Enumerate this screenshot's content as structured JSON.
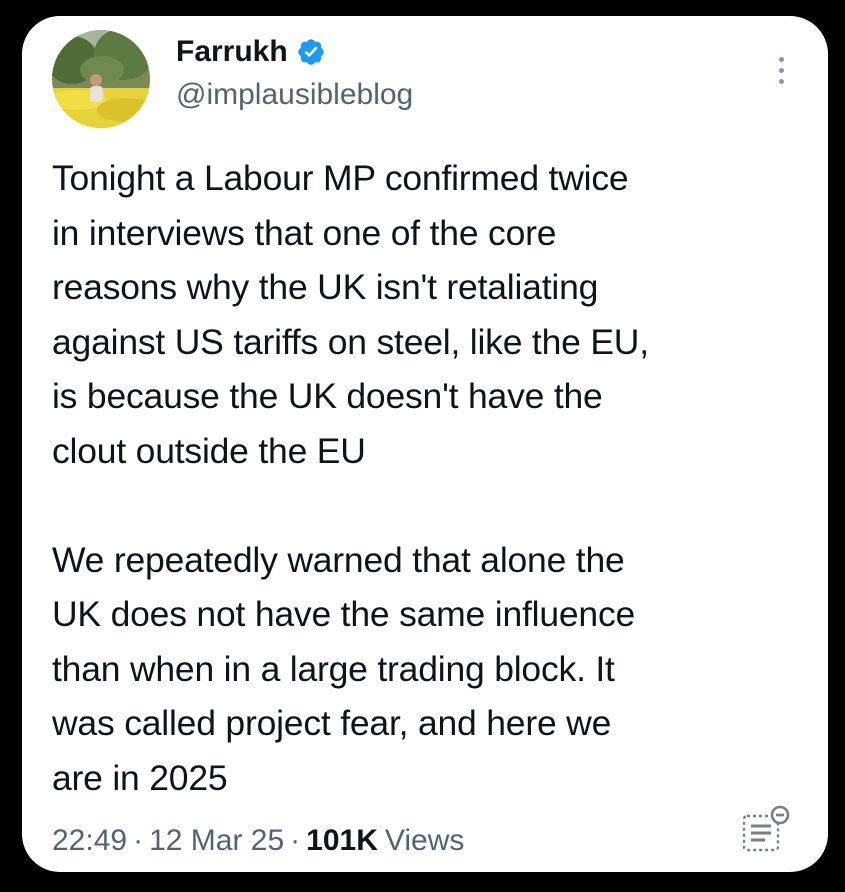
{
  "author": {
    "display_name": "Farrukh",
    "handle": "@implausibleblog",
    "verified_icon": "verified-badge-icon",
    "verified_color": "#1d9bf0"
  },
  "tweet": {
    "text": "Tonight a Labour MP confirmed twice\nin interviews that one of the core\nreasons why the UK isn't retaliating\nagainst US tariffs on steel, like the EU,\nis because the UK doesn't have the\nclout outside the EU\n\nWe repeatedly warned that alone the\nUK does not have the same influence\nthan when in a large trading block. It\nwas called project fear, and here we\nare in 2025"
  },
  "meta": {
    "time": "22:49",
    "separator": "·",
    "date": "12 Mar 25",
    "views_count": "101K",
    "views_label": "Views"
  },
  "icons": {
    "more": "more-vertical-icon",
    "reader": "reader-mode-icon"
  },
  "colors": {
    "background": "#000000",
    "card": "#ffffff",
    "text_primary": "#0f1419",
    "text_secondary": "#536471"
  }
}
